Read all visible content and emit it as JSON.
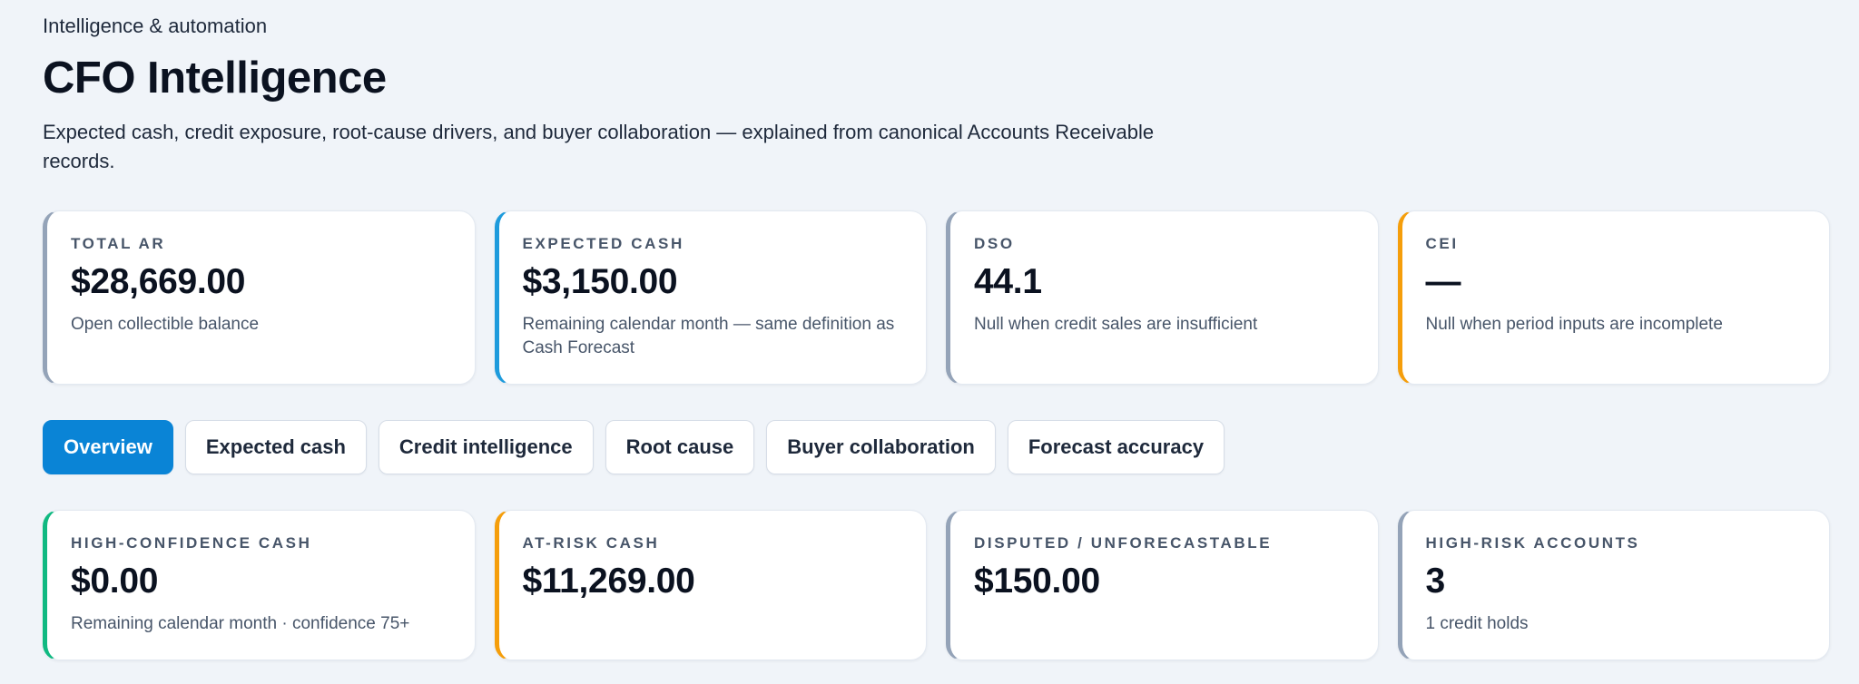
{
  "header": {
    "eyebrow": "Intelligence & automation",
    "title": "CFO Intelligence",
    "subtitle": "Expected cash, credit exposure, root-cause drivers, and buyer collaboration — explained from canonical Accounts Receivable records."
  },
  "summary_cards": [
    {
      "label": "TOTAL AR",
      "value": "$28,669.00",
      "note": "Open collectible balance",
      "accent": "#94a3b8"
    },
    {
      "label": "EXPECTED CASH",
      "value": "$3,150.00",
      "note": "Remaining calendar month — same definition as Cash Forecast",
      "accent": "#1e9bdc"
    },
    {
      "label": "DSO",
      "value": "44.1",
      "note": "Null when credit sales are insufficient",
      "accent": "#94a3b8"
    },
    {
      "label": "CEI",
      "value": "—",
      "note": "Null when period inputs are incomplete",
      "accent": "#f59e0b"
    }
  ],
  "tabs": [
    {
      "label": "Overview",
      "active": true
    },
    {
      "label": "Expected cash",
      "active": false
    },
    {
      "label": "Credit intelligence",
      "active": false
    },
    {
      "label": "Root cause",
      "active": false
    },
    {
      "label": "Buyer collaboration",
      "active": false
    },
    {
      "label": "Forecast accuracy",
      "active": false
    }
  ],
  "overview_cards": [
    {
      "label": "HIGH-CONFIDENCE CASH",
      "value": "$0.00",
      "note": "Remaining calendar month · confidence 75+",
      "accent": "#10b981"
    },
    {
      "label": "AT-RISK CASH",
      "value": "$11,269.00",
      "note": "",
      "accent": "#f59e0b"
    },
    {
      "label": "DISPUTED / UNFORECASTABLE",
      "value": "$150.00",
      "note": "",
      "accent": "#94a3b8"
    },
    {
      "label": "HIGH-RISK ACCOUNTS",
      "value": "3",
      "note": "1 credit holds",
      "accent": "#94a3b8"
    }
  ],
  "colors": {
    "primary": "#0a84d6",
    "background": "#f0f4f9"
  }
}
